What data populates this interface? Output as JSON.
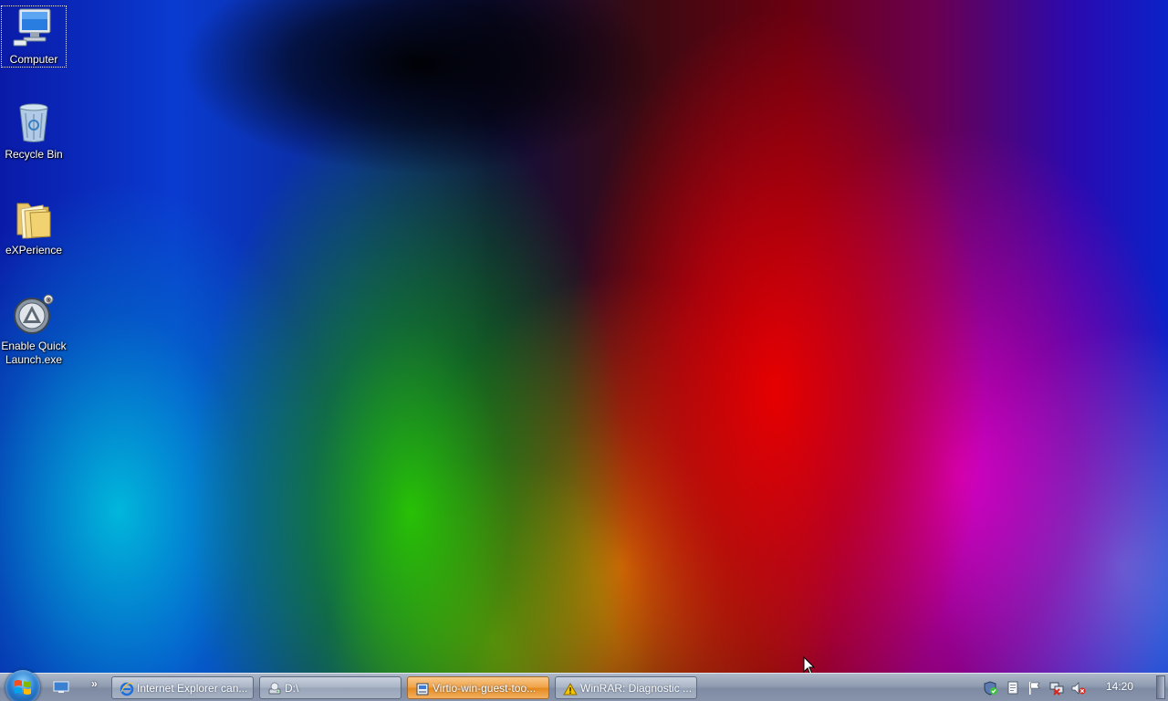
{
  "desktop": {
    "icons": [
      {
        "label": "Computer",
        "icon": "computer-icon"
      },
      {
        "label": "Recycle Bin",
        "icon": "recycle-bin-icon"
      },
      {
        "label": "eXPerience",
        "icon": "folder-icon"
      },
      {
        "label": "Enable Quick Launch.exe",
        "icon": "app-launcher-icon"
      }
    ]
  },
  "taskbar": {
    "tasks": [
      {
        "label": "Internet Explorer can...",
        "icon": "internet-explorer-icon",
        "active": false
      },
      {
        "label": "D:\\",
        "icon": "drive-icon",
        "active": false
      },
      {
        "label": "Virtio-win-guest-too...",
        "icon": "installer-icon",
        "active": true
      },
      {
        "label": "WinRAR: Diagnostic ...",
        "icon": "warning-icon",
        "active": false
      }
    ],
    "overflow_chevron": "»",
    "clock": "14:20",
    "tray_icons": [
      "security-shield-icon",
      "document-icon",
      "flag-icon",
      "network-icon",
      "volume-muted-icon"
    ]
  },
  "colors": {
    "taskbar": "#8f9bb0",
    "active_task": "#f0a248",
    "start_orb": "#2a7fd0"
  }
}
